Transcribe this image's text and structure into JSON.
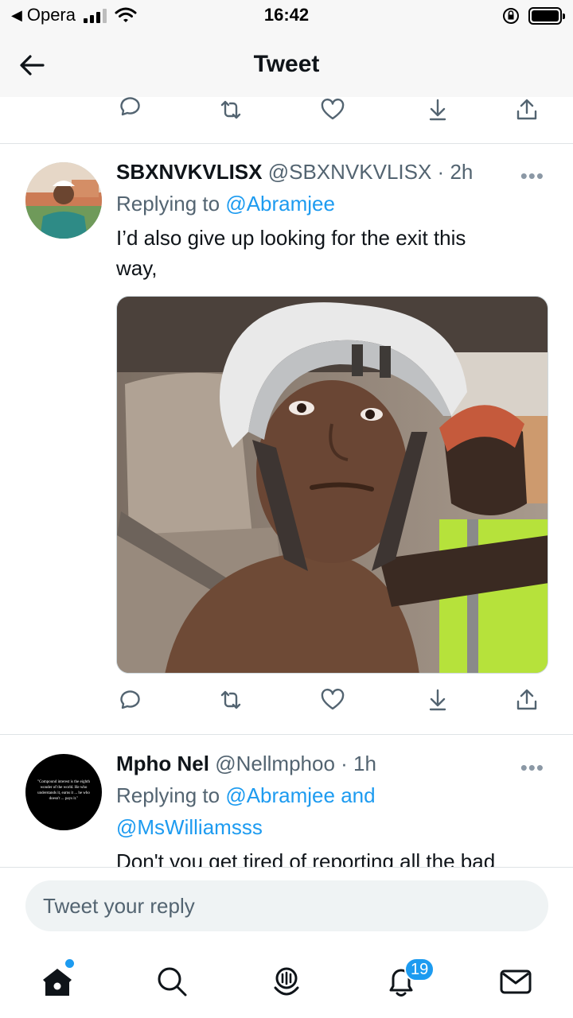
{
  "status_bar": {
    "app_back": "Opera",
    "time": "16:42"
  },
  "header": {
    "title": "Tweet"
  },
  "tweets": [
    {
      "display_name": "SBXNVKVLISX",
      "handle": "@SBXNVKVLISX",
      "time": "2h",
      "replying_prefix": "Replying to",
      "mentions": "@Abramjee",
      "text_line1": "I’d also give up looking for the exit this",
      "text_line2": "way,",
      "has_media": true
    },
    {
      "display_name": "Mpho Nel",
      "handle": "@Nellmphoo",
      "time": "1h",
      "replying_prefix": "Replying to",
      "mentions_line1": "@Abramjee and",
      "mentions_line2": "@MsWilliamsss",
      "text": "Don't you get tired of reporting all the bad",
      "avatar_quote": "\"Compound interest is the eighth wonder of the world. He who understands it, earns it ... he who doesn't ... pays it.\""
    }
  ],
  "composer": {
    "placeholder": "Tweet your reply"
  },
  "tabbar": {
    "notifications_count": "19",
    "icons": [
      "home-icon",
      "search-icon",
      "spaces-icon",
      "notifications-icon",
      "messages-icon"
    ]
  },
  "colors": {
    "accent": "#1d9bf0",
    "text_primary": "#0f1419",
    "text_secondary": "#536471",
    "divider": "#dfe3e6"
  }
}
